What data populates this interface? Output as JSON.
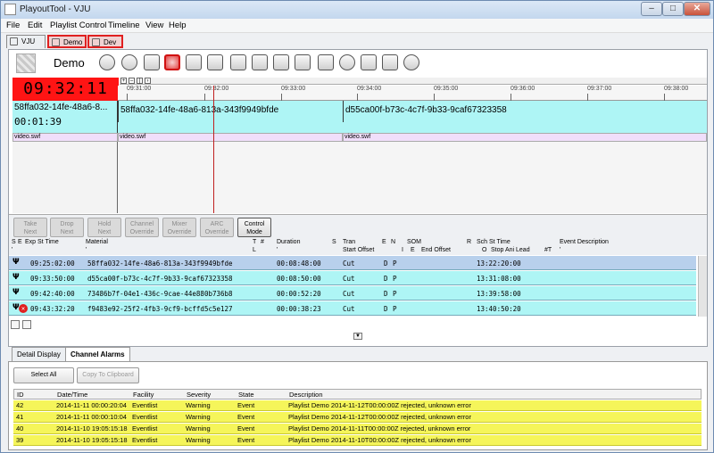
{
  "window": {
    "title": "PlayoutTool - VJU",
    "min": "–",
    "max": "□",
    "close": "✕"
  },
  "menu": [
    "File",
    "Edit",
    "Playlist Control",
    "Timeline",
    "View",
    "Help"
  ],
  "tabs": [
    "VJU",
    "Demo",
    "Dev"
  ],
  "playlist_name": "Demo",
  "clock": "09:32:11",
  "timeline": {
    "ticks": [
      "09:31:00",
      "09:32:00",
      "09:33:00",
      "09:34:00",
      "09:35:00",
      "09:36:00",
      "09:37:00",
      "09:38:00"
    ],
    "current_material": "58ffa032-14fe-48a6-8...",
    "current_remaining": "00:01:39",
    "events": [
      "58ffa032-14fe-48a6-813a-343f9949bfde",
      "d55ca00f-b73c-4c7f-9b33-9caf67323358"
    ],
    "layers": [
      "video.swf",
      "video.swf",
      "video.swf"
    ]
  },
  "controls": [
    {
      "l1": "Take",
      "l2": "Next"
    },
    {
      "l1": "Drop",
      "l2": "Next"
    },
    {
      "l1": "Hold",
      "l2": "Next"
    },
    {
      "l1": "Channel",
      "l2": "Override"
    },
    {
      "l1": "Mixer",
      "l2": "Override"
    },
    {
      "l1": "ARC",
      "l2": "Override"
    },
    {
      "l1": "Control",
      "l2": "Mode"
    }
  ],
  "grid": {
    "h1": {
      "s": "S",
      "e": "E",
      "exp": "Exp St Time",
      "mat": "Material",
      "t": "T",
      "hash": "#",
      "dur": "Duration",
      "s2": "S",
      "tran": "Tran",
      "e2": "E",
      "n": "N",
      "som": "SOM",
      "r": "R",
      "sch": "Sch St Time",
      "evd": "Event Description"
    },
    "h2": {
      "q1": "'",
      "q2": "'",
      "l": "L",
      "q3": "'",
      "so": "Start Offset",
      "i": "I",
      "e3": "E",
      "eo": "End Offset",
      "o": "O",
      "sal": "Stop Ani Lead",
      "t2": "#T",
      "q4": "'"
    },
    "rows": [
      {
        "exp": "09:25:02:00",
        "mat": "58ffa032-14fe-48a6-813a-343f9949bfde",
        "dur": "00:08:48:00",
        "tran": "Cut",
        "d": "D",
        "p": "P",
        "sch": "13:22:20:00",
        "rej": false
      },
      {
        "exp": "09:33:50:00",
        "mat": "d55ca00f-b73c-4c7f-9b33-9caf67323358",
        "dur": "00:08:50:00",
        "tran": "Cut",
        "d": "D",
        "p": "P",
        "sch": "13:31:08:00",
        "rej": false
      },
      {
        "exp": "09:42:40:00",
        "mat": "73486b7f-04e1-436c-9cae-44e880b736b8",
        "dur": "00:00:52:20",
        "tran": "Cut",
        "d": "D",
        "p": "P",
        "sch": "13:39:58:00",
        "rej": false
      },
      {
        "exp": "09:43:32:20",
        "mat": "f9483e92-25f2-4fb3-9cf9-bcffd5c5e127",
        "dur": "00:00:38:23",
        "tran": "Cut",
        "d": "D",
        "p": "P",
        "sch": "13:40:50:20",
        "rej": true
      }
    ]
  },
  "bottom": {
    "tabs": [
      "Detail Display",
      "Channel Alarms"
    ],
    "select_all": "Select All",
    "copy": "Copy To Clipboard",
    "columns": [
      "ID",
      "Date/Time",
      "Facility",
      "Severity",
      "State",
      "Description"
    ],
    "rows": [
      [
        "42",
        "2014-11-11 00:00:20:04",
        "Eventlist",
        "Warning",
        "Event",
        "Playlist Demo 2014-11-12T00:00:00Z rejected, unknown error"
      ],
      [
        "41",
        "2014-11-11 00:00:10:04",
        "Eventlist",
        "Warning",
        "Event",
        "Playlist Demo 2014-11-12T00:00:00Z rejected, unknown error"
      ],
      [
        "40",
        "2014-11-10 19:05:15:18",
        "Eventlist",
        "Warning",
        "Event",
        "Playlist Demo 2014-11-11T00:00:00Z rejected, unknown error"
      ],
      [
        "39",
        "2014-11-10 19:05:15:18",
        "Eventlist",
        "Warning",
        "Event",
        "Playlist Demo 2014-11-10T00:00:00Z rejected, unknown error"
      ]
    ]
  },
  "colors": {
    "clock_bg": "#ff1414",
    "event_bg": "#aef5f5",
    "selected_row": "#b8d0ec",
    "alarm_row": "#f5f55a",
    "playhead": "#c02020"
  }
}
